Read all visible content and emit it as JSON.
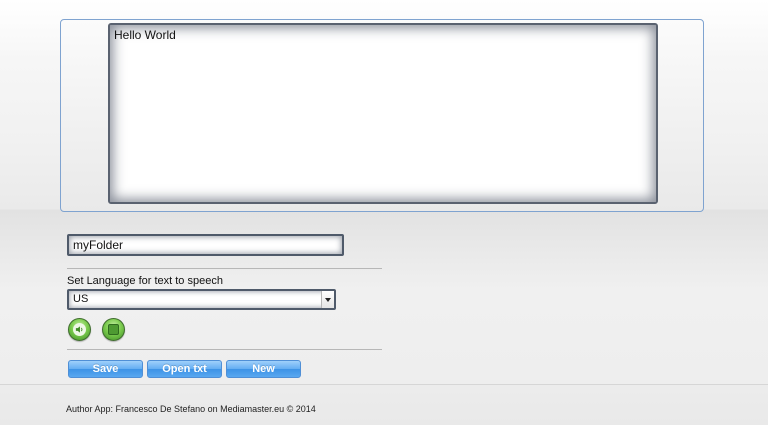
{
  "editor": {
    "text": "Hello World"
  },
  "folder_field": {
    "value": "myFolder"
  },
  "language": {
    "label": "Set Language for text to speech",
    "selected": "US"
  },
  "tts_controls": {
    "speak_icon": "speaker-icon",
    "stop_icon": "stop-icon"
  },
  "actions": {
    "save_label": "Save",
    "open_label": "Open txt",
    "new_label": "New"
  },
  "footer": {
    "text": "Author App: Francesco De Stefano on Mediamaster.eu © 2014"
  },
  "colors": {
    "button_blue": "#5aa6ef",
    "tts_green": "#5fb23a",
    "panel_border": "#7fa3d0"
  }
}
